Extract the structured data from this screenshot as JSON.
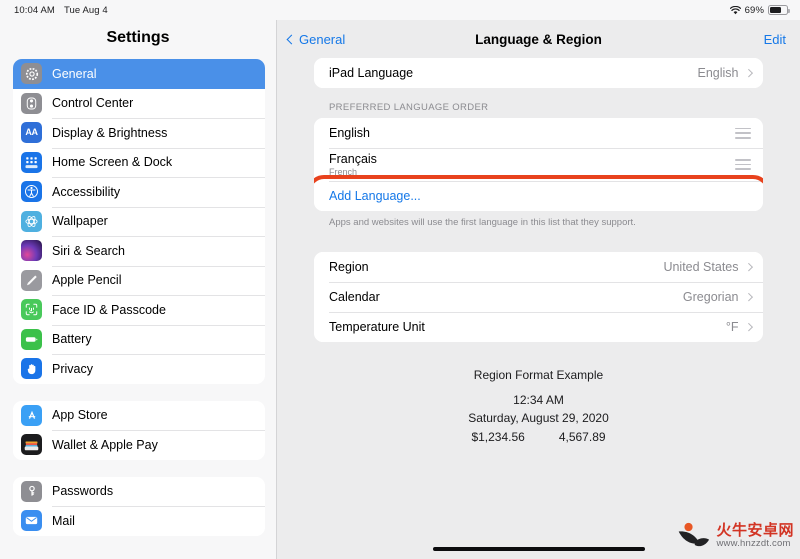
{
  "status_bar": {
    "time": "10:04 AM",
    "date": "Tue Aug 4",
    "wifi_icon": "wifi-icon",
    "battery_percent": "69%",
    "battery_icon": "battery-icon"
  },
  "sidebar": {
    "title": "Settings",
    "groups": [
      {
        "items": [
          {
            "label": "General",
            "icon": "gear-icon",
            "selected": true
          },
          {
            "label": "Control Center",
            "icon": "control-center-icon",
            "selected": false
          },
          {
            "label": "Display & Brightness",
            "icon": "display-brightness-icon",
            "selected": false
          },
          {
            "label": "Home Screen & Dock",
            "icon": "home-screen-dock-icon",
            "selected": false
          },
          {
            "label": "Accessibility",
            "icon": "accessibility-icon",
            "selected": false
          },
          {
            "label": "Wallpaper",
            "icon": "wallpaper-icon",
            "selected": false
          },
          {
            "label": "Siri & Search",
            "icon": "siri-icon",
            "selected": false
          },
          {
            "label": "Apple Pencil",
            "icon": "apple-pencil-icon",
            "selected": false
          },
          {
            "label": "Face ID & Passcode",
            "icon": "face-id-icon",
            "selected": false
          },
          {
            "label": "Battery",
            "icon": "battery-settings-icon",
            "selected": false
          },
          {
            "label": "Privacy",
            "icon": "privacy-hand-icon",
            "selected": false
          }
        ]
      },
      {
        "items": [
          {
            "label": "App Store",
            "icon": "app-store-icon",
            "selected": false
          },
          {
            "label": "Wallet & Apple Pay",
            "icon": "wallet-icon",
            "selected": false
          }
        ]
      },
      {
        "items": [
          {
            "label": "Passwords",
            "icon": "passwords-key-icon",
            "selected": false
          },
          {
            "label": "Mail",
            "icon": "mail-icon",
            "selected": false
          }
        ]
      }
    ]
  },
  "detail": {
    "nav": {
      "back_label": "General",
      "back_icon": "chevron-left-icon",
      "title": "Language & Region",
      "edit_label": "Edit"
    },
    "ipad_language": {
      "label": "iPad Language",
      "value": "English"
    },
    "preferred_order": {
      "section_label": "PREFERRED LANGUAGE ORDER",
      "languages": [
        {
          "name": "English",
          "sub": ""
        },
        {
          "name": "Français",
          "sub": "French"
        }
      ],
      "add_language_label": "Add Language...",
      "footnote": "Apps and websites will use the first language in this list that they support."
    },
    "region_settings": [
      {
        "label": "Region",
        "value": "United States"
      },
      {
        "label": "Calendar",
        "value": "Gregorian"
      },
      {
        "label": "Temperature Unit",
        "value": "°F"
      }
    ],
    "region_example": {
      "title": "Region Format Example",
      "time": "12:34 AM",
      "date": "Saturday, August 29, 2020",
      "currency": "$1,234.56",
      "number": "4,567.89"
    }
  },
  "highlight": {
    "color": "#e8421d",
    "target": "add-language-row"
  },
  "watermark": {
    "brand_cn": "火牛安卓网",
    "url": "www.hnzzdt.com"
  }
}
